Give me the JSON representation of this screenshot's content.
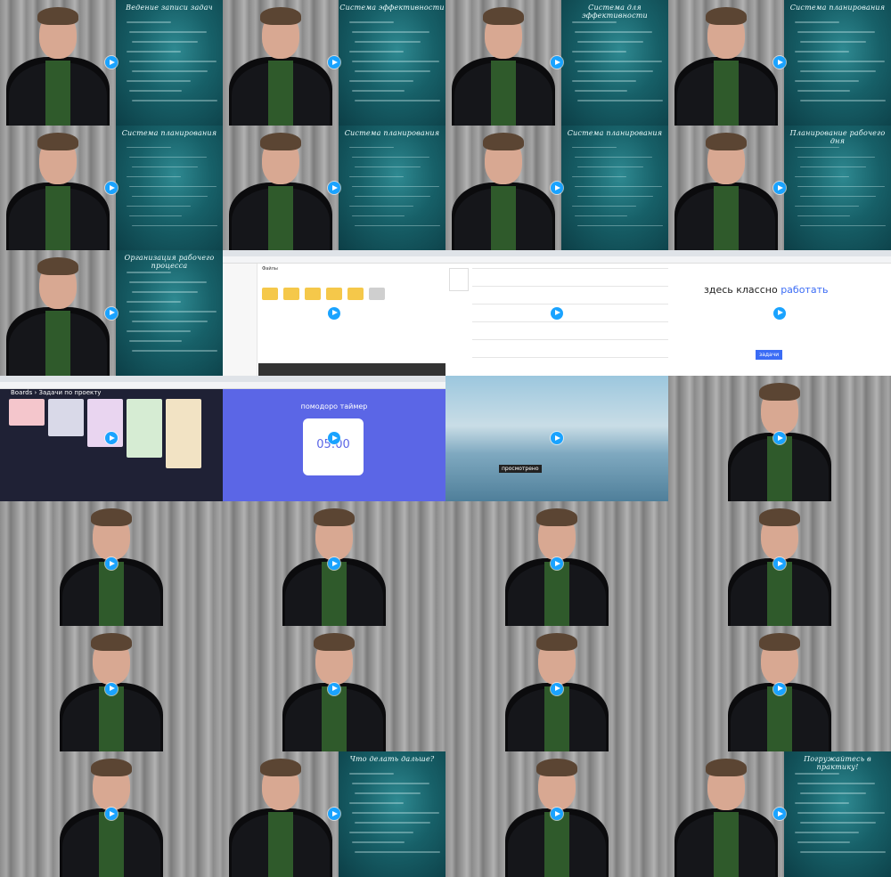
{
  "grid": {
    "rows": 7,
    "cols": 4,
    "thumbnails": [
      {
        "type": "speaker+board",
        "board_title": "Ведение записи задач"
      },
      {
        "type": "speaker+board",
        "board_title": "Система эффективности"
      },
      {
        "type": "speaker+board",
        "board_title": "Система для эффективности"
      },
      {
        "type": "speaker+board",
        "board_title": "Система планирования"
      },
      {
        "type": "speaker+board",
        "board_title": "Система планирования"
      },
      {
        "type": "speaker+board",
        "board_title": "Система планирования"
      },
      {
        "type": "speaker+board",
        "board_title": "Система планирования"
      },
      {
        "type": "speaker+board",
        "board_title": "Планирование рабочего дня"
      },
      {
        "type": "speaker+board",
        "board_title": "Организация рабочего процесса"
      },
      {
        "type": "screen",
        "app": "cloud-files",
        "heading": "Файлы"
      },
      {
        "type": "screen",
        "app": "calendar"
      },
      {
        "type": "screen",
        "app": "landing",
        "headline": "здесь классно",
        "headline_accent": "работать",
        "button": "задачи"
      },
      {
        "type": "screen",
        "app": "kanban",
        "breadcrumb_root": "Boards",
        "breadcrumb_page": "Задачи по проекту"
      },
      {
        "type": "screen",
        "app": "pomodoro",
        "title": "помодоро таймер",
        "timer": "05:00"
      },
      {
        "type": "screen",
        "app": "sky",
        "caption": "просмотрено"
      },
      {
        "type": "speaker"
      },
      {
        "type": "speaker"
      },
      {
        "type": "speaker"
      },
      {
        "type": "speaker"
      },
      {
        "type": "speaker"
      },
      {
        "type": "speaker"
      },
      {
        "type": "speaker"
      },
      {
        "type": "speaker"
      },
      {
        "type": "speaker"
      },
      {
        "type": "speaker"
      },
      {
        "type": "speaker+board",
        "board_title": "Что делать дальше?"
      },
      {
        "type": "speaker"
      },
      {
        "type": "speaker+board",
        "board_title": "Погружайтесь в практику!"
      }
    ]
  },
  "colors": {
    "play": "#1aa3ff",
    "board": "#176068",
    "shirt": "#2f5a2b"
  }
}
